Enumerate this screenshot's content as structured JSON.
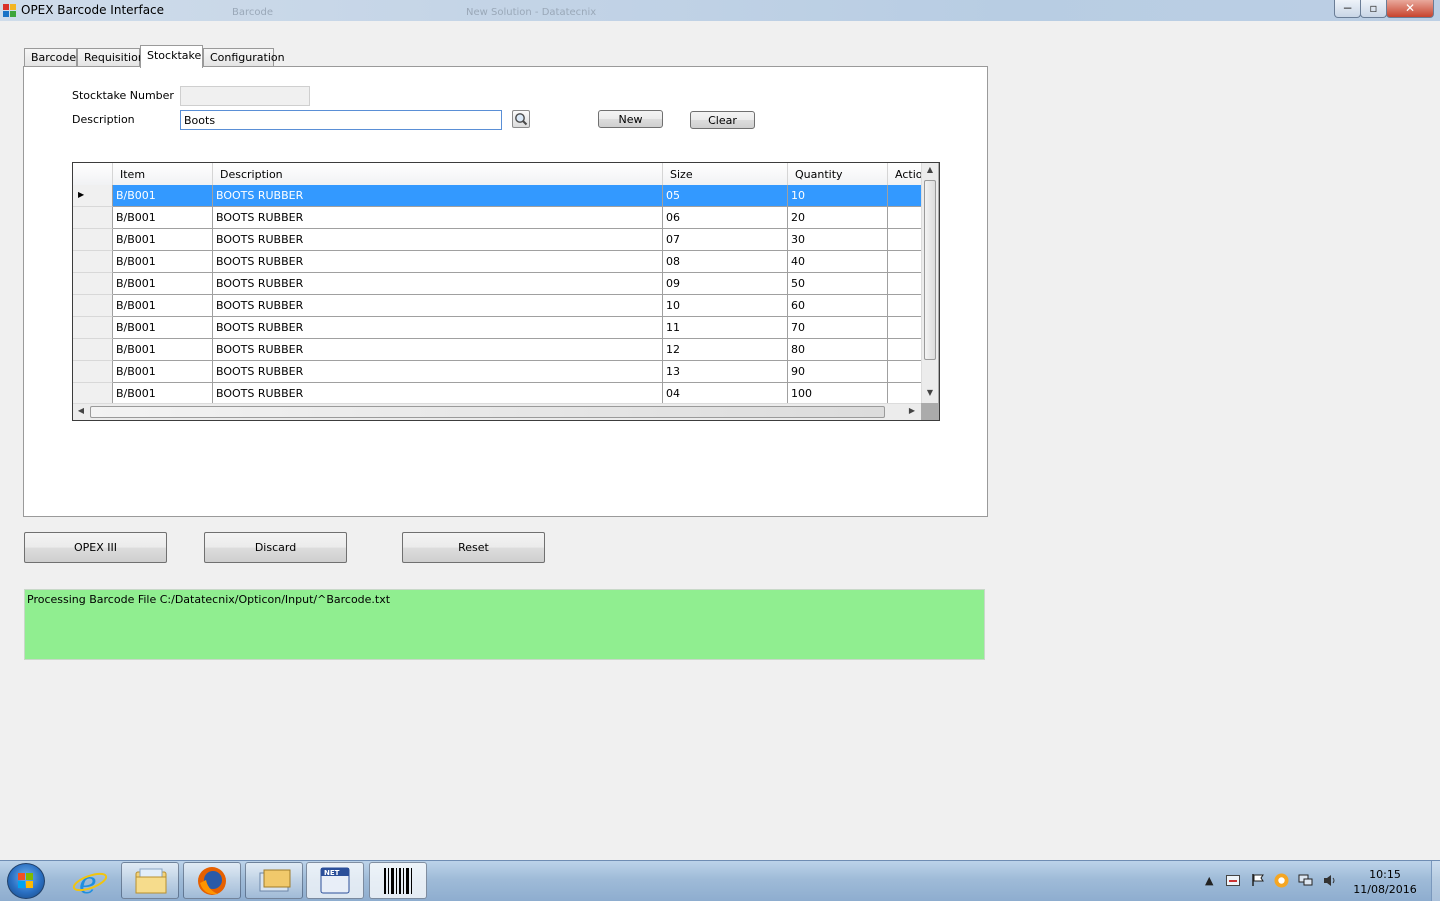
{
  "window": {
    "title": "OPEX Barcode Interface",
    "background_tabs": [
      "Barcode",
      "New Solution - Datatecnix"
    ],
    "controls": {
      "minimize": "−",
      "maximize": "▫",
      "close": "✕"
    }
  },
  "tabs": [
    {
      "label": "Barcode",
      "active": false
    },
    {
      "label": "Requisition",
      "active": false
    },
    {
      "label": "Stocktake",
      "active": true
    },
    {
      "label": "Configuration",
      "active": false
    }
  ],
  "form": {
    "stocktake_number_label": "Stocktake Number",
    "stocktake_number_value": "",
    "description_label": "Description",
    "description_value": "Boots",
    "search_icon": "magnifier-icon",
    "new_button": "New",
    "clear_button": "Clear"
  },
  "grid": {
    "columns": [
      "Item",
      "Description",
      "Size",
      "Quantity",
      "Action"
    ],
    "selected_row": 0,
    "rows": [
      [
        "B/B001",
        "BOOTS RUBBER",
        "05",
        "10",
        ""
      ],
      [
        "B/B001",
        "BOOTS RUBBER",
        "06",
        "20",
        ""
      ],
      [
        "B/B001",
        "BOOTS RUBBER",
        "07",
        "30",
        ""
      ],
      [
        "B/B001",
        "BOOTS RUBBER",
        "08",
        "40",
        ""
      ],
      [
        "B/B001",
        "BOOTS RUBBER",
        "09",
        "50",
        ""
      ],
      [
        "B/B001",
        "BOOTS RUBBER",
        "10",
        "60",
        ""
      ],
      [
        "B/B001",
        "BOOTS RUBBER",
        "11",
        "70",
        ""
      ],
      [
        "B/B001",
        "BOOTS RUBBER",
        "12",
        "80",
        ""
      ],
      [
        "B/B001",
        "BOOTS RUBBER",
        "13",
        "90",
        ""
      ],
      [
        "B/B001",
        "BOOTS RUBBER",
        "04",
        "100",
        ""
      ]
    ]
  },
  "actions": {
    "opex_button": "OPEX III",
    "discard_button": "Discard",
    "reset_button": "Reset"
  },
  "status": {
    "message": "Processing Barcode File C:/Datatecnix/Opticon/Input/^Barcode.txt",
    "color": "#90ee90"
  },
  "taskbar": {
    "items": [
      "internet-explorer-icon",
      "file-explorer-icon",
      "firefox-icon",
      "window-switcher-icon",
      "dotnet-app-icon",
      "barcode-app-icon"
    ],
    "time": "10:15",
    "date": "11/08/2016"
  }
}
